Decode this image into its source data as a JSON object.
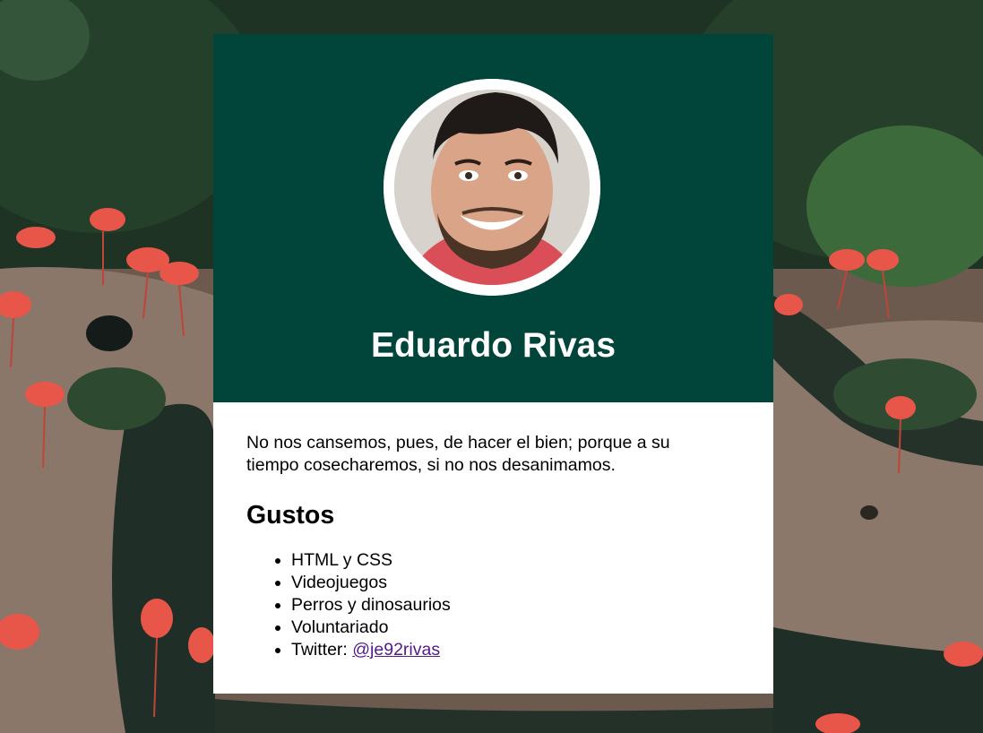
{
  "profile": {
    "name": "Eduardo Rivas",
    "avatar": "profile-photo"
  },
  "bio": {
    "quote": "No nos cansemos, pues, de hacer el bien; porque a su tiempo cosecharemos, si no nos desanimamos."
  },
  "likes": {
    "heading": "Gustos",
    "items": [
      "HTML y CSS",
      "Videojuegos",
      "Perros y dinosaurios",
      "Voluntariado"
    ],
    "twitter_prefix": "Twitter: ",
    "twitter_handle": "@je92rivas"
  },
  "colors": {
    "header_bg": "#00443a",
    "card_bg": "#ffffff",
    "link": "#551a8b"
  },
  "background": "flamingo-pond-photo"
}
